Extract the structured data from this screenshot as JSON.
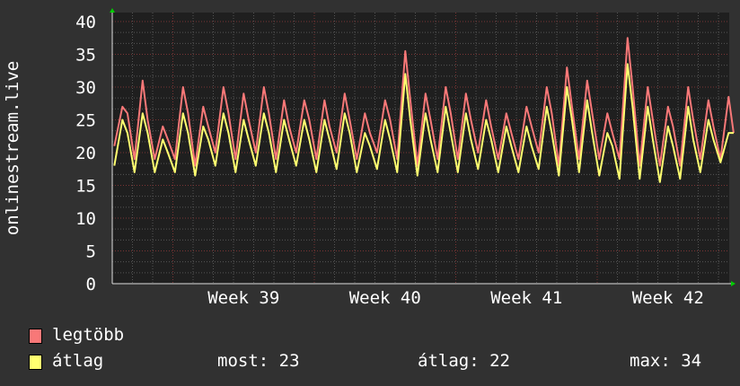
{
  "chart_data": {
    "type": "line",
    "ylabel": "onlinestream.live",
    "ylim": [
      0,
      40
    ],
    "xlim_days": [
      0,
      30.5
    ],
    "yticks": [
      "0",
      "5",
      "10",
      "15",
      "20",
      "25",
      "30",
      "35",
      "40"
    ],
    "xticks": [
      {
        "label": "Week 39",
        "day": 6.5
      },
      {
        "label": "Week 40",
        "day": 13.5
      },
      {
        "label": "Week 41",
        "day": 20.5
      },
      {
        "label": "Week 42",
        "day": 27.5
      }
    ],
    "week_boundaries_days": [
      3,
      10,
      17,
      24
    ],
    "grid": true,
    "point_offsets_in_day": [
      0.1,
      0.5,
      0.75
    ],
    "series": [
      {
        "name": "legtöbb",
        "color": "#f87878",
        "values": [
          21,
          27,
          26,
          19,
          31,
          25,
          19,
          24,
          22,
          19,
          30,
          26,
          18,
          27,
          24,
          20,
          30,
          26,
          19,
          29,
          25,
          20,
          30,
          26,
          19,
          28,
          24,
          20,
          28,
          25,
          19,
          28,
          24,
          20,
          29,
          25,
          19,
          26,
          23,
          20,
          28,
          25,
          19,
          35.5,
          28,
          18,
          29,
          25,
          19,
          30,
          26,
          19,
          29,
          25,
          20,
          28,
          24,
          19,
          26,
          23,
          19,
          27,
          24,
          20,
          30,
          26,
          18,
          33,
          27,
          19,
          31,
          26,
          19,
          26,
          23,
          19,
          37.5,
          30,
          18,
          30,
          25,
          18,
          27,
          24,
          18,
          30,
          25,
          19,
          28,
          24,
          19,
          28.5,
          23
        ]
      },
      {
        "name": "átlag",
        "color": "#ffff70",
        "values": [
          18,
          25,
          23,
          17,
          26,
          23,
          17,
          22,
          20,
          17,
          26,
          23,
          16.5,
          24,
          22,
          18,
          26,
          23,
          17,
          25,
          22,
          18,
          26,
          23,
          17,
          25,
          22,
          18,
          25,
          22,
          17,
          25,
          22,
          17.5,
          26,
          23,
          17,
          23,
          21,
          17.5,
          25,
          22,
          17,
          32,
          25,
          16.5,
          26,
          22,
          17,
          27,
          23,
          17,
          26,
          22,
          17.5,
          25,
          22,
          17,
          24,
          21,
          17,
          24,
          21,
          17.5,
          27,
          23,
          16.5,
          30,
          25,
          17,
          28,
          23,
          16.5,
          23,
          21,
          16,
          33.5,
          27,
          16,
          27,
          22,
          15.5,
          24,
          21,
          16,
          27,
          22,
          17,
          25,
          22,
          18.5,
          23,
          23
        ]
      }
    ],
    "legend": {
      "max_label": "legtöbb",
      "avg_label": "átlag",
      "stats": {
        "most": "most: 23",
        "atlag": "átlag: 22",
        "max": "max: 34"
      }
    }
  }
}
